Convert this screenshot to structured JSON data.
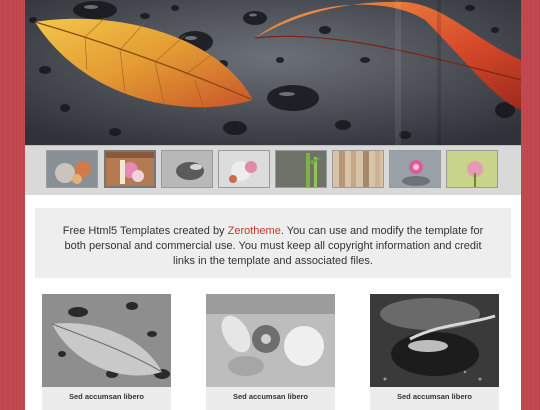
{
  "slider": {
    "image": "leaves-with-water-droplets",
    "colors": {
      "background": "#3a3d44",
      "leaf_left": "#e8a33a",
      "leaf_right": "#d9442a"
    }
  },
  "thumbnails": [
    {
      "name": "thumb-1",
      "subject": "flower-stones",
      "active": false
    },
    {
      "name": "thumb-2",
      "subject": "pink-flower-wood",
      "active": true
    },
    {
      "name": "thumb-3",
      "subject": "stones-gray",
      "active": false
    },
    {
      "name": "thumb-4",
      "subject": "flower-bowl",
      "active": false
    },
    {
      "name": "thumb-5",
      "subject": "bamboo",
      "active": false
    },
    {
      "name": "thumb-6",
      "subject": "wood-bamboo",
      "active": false
    },
    {
      "name": "thumb-7",
      "subject": "orchid-stones",
      "active": false
    },
    {
      "name": "thumb-8",
      "subject": "green-pink-flower",
      "active": false
    }
  ],
  "notice": {
    "text_before": "Free Html5 Templates created by ",
    "brand": "Zerotheme",
    "text_after": ". You can use and modify the template for both personal and commercial use. You must keep all copyright information and credit links in the template and associated files."
  },
  "cards": [
    {
      "caption": "Sed accumsan libero",
      "image": "leaf-droplets-bw"
    },
    {
      "caption": "Sed accumsan libero",
      "image": "orchid-spa-bw"
    },
    {
      "caption": "Sed accumsan libero",
      "image": "leaf-on-stones-bw"
    }
  ],
  "colors": {
    "page_background": "#c0454d",
    "accent": "#c0392b",
    "notice_background": "#eeeeee"
  }
}
